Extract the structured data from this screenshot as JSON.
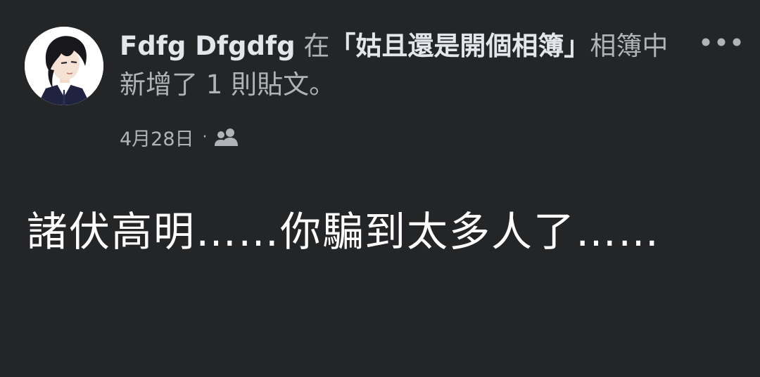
{
  "post": {
    "author": "Fdfg Dfgdfg",
    "action_prefix": " 在",
    "album_name": "「姑且還是開個相簿」",
    "action_suffix": "相簿中新增了 1 則貼文。",
    "date": "4月28日",
    "separator": "·",
    "audience_icon": "friends-icon",
    "more_icon": "more-options-icon",
    "body_text": "諸伏高明……你騙到太多人了……"
  },
  "colors": {
    "background": "#242527",
    "primary_text": "#e4e6eb",
    "secondary_text": "#b0b3b8",
    "body_text": "#ffffff"
  }
}
